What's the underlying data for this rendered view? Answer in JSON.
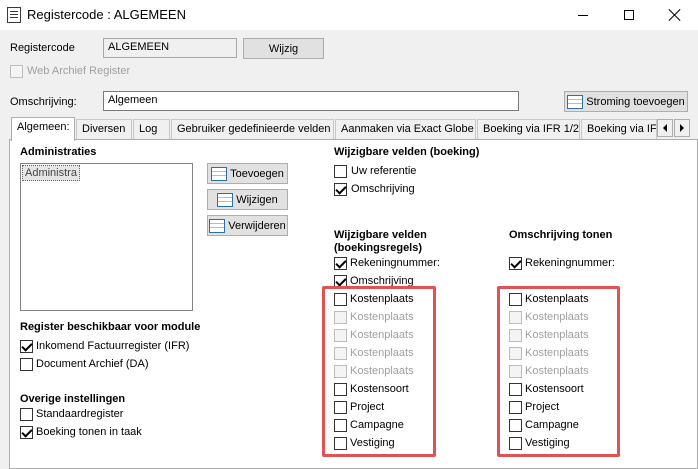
{
  "window": {
    "title": "Registercode : ALGEMEEN"
  },
  "header": {
    "registercode_label": "Registercode",
    "registercode_value": "ALGEMEEN",
    "wijzig_label": "Wijzig",
    "web_archief_label": "Web Archief Register",
    "omschrijving_label": "Omschrijving:",
    "omschrijving_value": "Algemeen",
    "stroming_label": "Stroming toevoegen"
  },
  "tabs": [
    {
      "label": "Algemeen:",
      "active": true
    },
    {
      "label": "Diversen"
    },
    {
      "label": "Log"
    },
    {
      "label": "Gebruiker gedefinieerde velden"
    },
    {
      "label": "Aanmaken via Exact Globe"
    },
    {
      "label": "Boeking via IFR 1/2"
    },
    {
      "label": "Boeking via IFR"
    }
  ],
  "administraties": {
    "heading": "Administraties",
    "items": [
      "Administra"
    ],
    "toevoegen_label": "Toevoegen",
    "wijzigen_label": "Wijzigen",
    "verwijderen_label": "Verwijderen"
  },
  "module": {
    "heading": "Register beschikbaar voor module",
    "items": [
      {
        "label": "Inkomend Factuurregister (IFR)",
        "checked": true
      },
      {
        "label": "Document Archief (DA)",
        "checked": false
      }
    ]
  },
  "overige": {
    "heading": "Overige instellingen",
    "items": [
      {
        "label": "Standaardregister",
        "checked": false
      },
      {
        "label": "Boeking tonen in taak",
        "checked": true
      }
    ]
  },
  "wijzigbaar_boeking": {
    "heading": "Wijzigbare velden (boeking)",
    "items": [
      {
        "label": "Uw referentie",
        "checked": false
      },
      {
        "label": "Omschrijving",
        "checked": true
      }
    ]
  },
  "wijzigbaar_regels": {
    "heading_line1": "Wijzigbare velden",
    "heading_line2": "(boekingsregels)",
    "items": [
      {
        "label": "Rekeningnummer:",
        "checked": true,
        "disabled": false
      },
      {
        "label": "Omschrijving",
        "checked": true,
        "disabled": false
      },
      {
        "label": "Kostenplaats",
        "checked": false,
        "disabled": false
      },
      {
        "label": "Kostenplaats",
        "checked": false,
        "disabled": true
      },
      {
        "label": "Kostenplaats",
        "checked": false,
        "disabled": true
      },
      {
        "label": "Kostenplaats",
        "checked": false,
        "disabled": true
      },
      {
        "label": "Kostenplaats",
        "checked": false,
        "disabled": true
      },
      {
        "label": "Kostensoort",
        "checked": false,
        "disabled": false
      },
      {
        "label": "Project",
        "checked": false,
        "disabled": false
      },
      {
        "label": "Campagne",
        "checked": false,
        "disabled": false
      },
      {
        "label": "Vestiging",
        "checked": false,
        "disabled": false
      }
    ]
  },
  "omschrijving_tonen": {
    "heading": "Omschrijving tonen",
    "items": [
      {
        "label": "Rekeningnummer:",
        "checked": true,
        "disabled": false
      },
      {
        "label": "Kostenplaats",
        "checked": false,
        "disabled": false
      },
      {
        "label": "Kostenplaats",
        "checked": false,
        "disabled": true
      },
      {
        "label": "Kostenplaats",
        "checked": false,
        "disabled": true
      },
      {
        "label": "Kostenplaats",
        "checked": false,
        "disabled": true
      },
      {
        "label": "Kostenplaats",
        "checked": false,
        "disabled": true
      },
      {
        "label": "Kostensoort",
        "checked": false,
        "disabled": false
      },
      {
        "label": "Project",
        "checked": false,
        "disabled": false
      },
      {
        "label": "Campagne",
        "checked": false,
        "disabled": false
      },
      {
        "label": "Vestiging",
        "checked": false,
        "disabled": false
      }
    ]
  },
  "colors": {
    "highlight_box": "#e15252"
  }
}
